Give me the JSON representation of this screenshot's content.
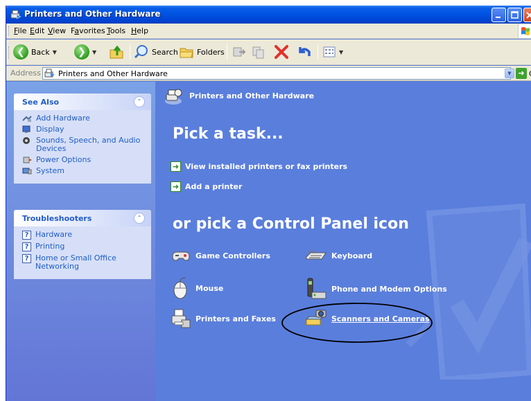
{
  "window": {
    "title": "Printers and Other Hardware"
  },
  "menu": [
    {
      "key": "F",
      "rest": "ile"
    },
    {
      "key": "E",
      "rest": "dit"
    },
    {
      "key": "V",
      "rest": "iew"
    },
    {
      "key": "a",
      "pre": "F",
      "rest": "vorites"
    },
    {
      "key": "T",
      "rest": "ools"
    },
    {
      "key": "H",
      "rest": "elp"
    }
  ],
  "toolbar": {
    "back_label": "Back",
    "search_label": "Search",
    "folders_label": "Folders"
  },
  "address": {
    "label": "Address",
    "value": "Printers and Other Hardware",
    "go_label": "Go"
  },
  "see_also": {
    "title": "See Also",
    "items": [
      {
        "icon": "add-hardware-icon",
        "label": "Add Hardware"
      },
      {
        "icon": "display-icon",
        "label": "Display"
      },
      {
        "icon": "sounds-icon",
        "label": "Sounds, Speech, and Audio Devices"
      },
      {
        "icon": "power-options-icon",
        "label": "Power Options"
      },
      {
        "icon": "system-icon",
        "label": "System"
      }
    ]
  },
  "troubleshooters": {
    "title": "Troubleshooters",
    "items": [
      {
        "icon": "help-icon",
        "label": "Hardware"
      },
      {
        "icon": "help-icon",
        "label": "Printing"
      },
      {
        "icon": "help-icon",
        "label": "Home or Small Office Networking"
      }
    ]
  },
  "main": {
    "header_title": "Printers and Other Hardware",
    "pick_task": "Pick a task...",
    "tasks": [
      {
        "label": "View installed printers or fax printers"
      },
      {
        "label": "Add a printer"
      }
    ],
    "pick_icon": "or pick a Control Panel icon",
    "icons": [
      {
        "icon": "game-controller-icon",
        "label": "Game Controllers"
      },
      {
        "icon": "keyboard-icon",
        "label": "Keyboard"
      },
      {
        "icon": "mouse-icon",
        "label": "Mouse"
      },
      {
        "icon": "phone-modem-icon",
        "label": "Phone and Modem Options"
      },
      {
        "icon": "printer-fax-icon",
        "label": "Printers and Faxes"
      },
      {
        "icon": "scanner-camera-icon",
        "label": "Scanners and Cameras"
      }
    ]
  },
  "colors": {
    "main_bg": "#5a7edc",
    "link_blue": "#215dc6",
    "titlebar": "#0054e3",
    "highlight_ellipse": "#000000"
  }
}
